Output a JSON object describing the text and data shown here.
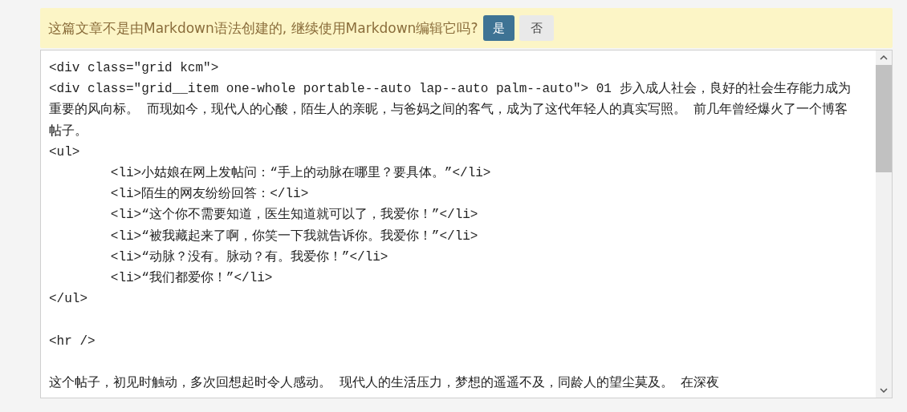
{
  "notice": {
    "message": "这篇文章不是由Markdown语法创建的, 继续使用Markdown编辑它吗?",
    "buttons": [
      {
        "label": "是",
        "kind": "primary"
      },
      {
        "label": "否",
        "kind": "default"
      }
    ]
  },
  "editor": {
    "lines": [
      "<div class=\"grid kcm\">",
      "<div class=\"grid__item one-whole portable--auto lap--auto palm--auto\"> 01 步入成人社会，良好的社会生存能力成为重要的风向标。 而现如今，现代人的心酸，陌生人的亲昵，与爸妈之间的客气，成为了这代年轻人的真实写照。 前几年曾经爆火了一个博客帖子。",
      "<ul>",
      "\t<li>小姑娘在网上发帖问：“手上的动脉在哪里？要具体。”</li>",
      "\t<li>陌生的网友纷纷回答：</li>",
      "\t<li>“这个你不需要知道，医生知道就可以了，我爱你！”</li>",
      "\t<li>“被我藏起来了啊，你笑一下我就告诉你。我爱你！”</li>",
      "\t<li>“动脉？没有。脉动？有。我爱你！”</li>",
      "\t<li>“我们都爱你！”</li>",
      "</ul>",
      {
        "kind": "blank"
      },
      "<hr />",
      {
        "kind": "blank"
      },
      "这个帖子，初见时触动，多次回想起时令人感动。 现代人的生活压力，梦想的遥遥不及，同龄人的望尘莫及。 在深夜"
    ]
  }
}
